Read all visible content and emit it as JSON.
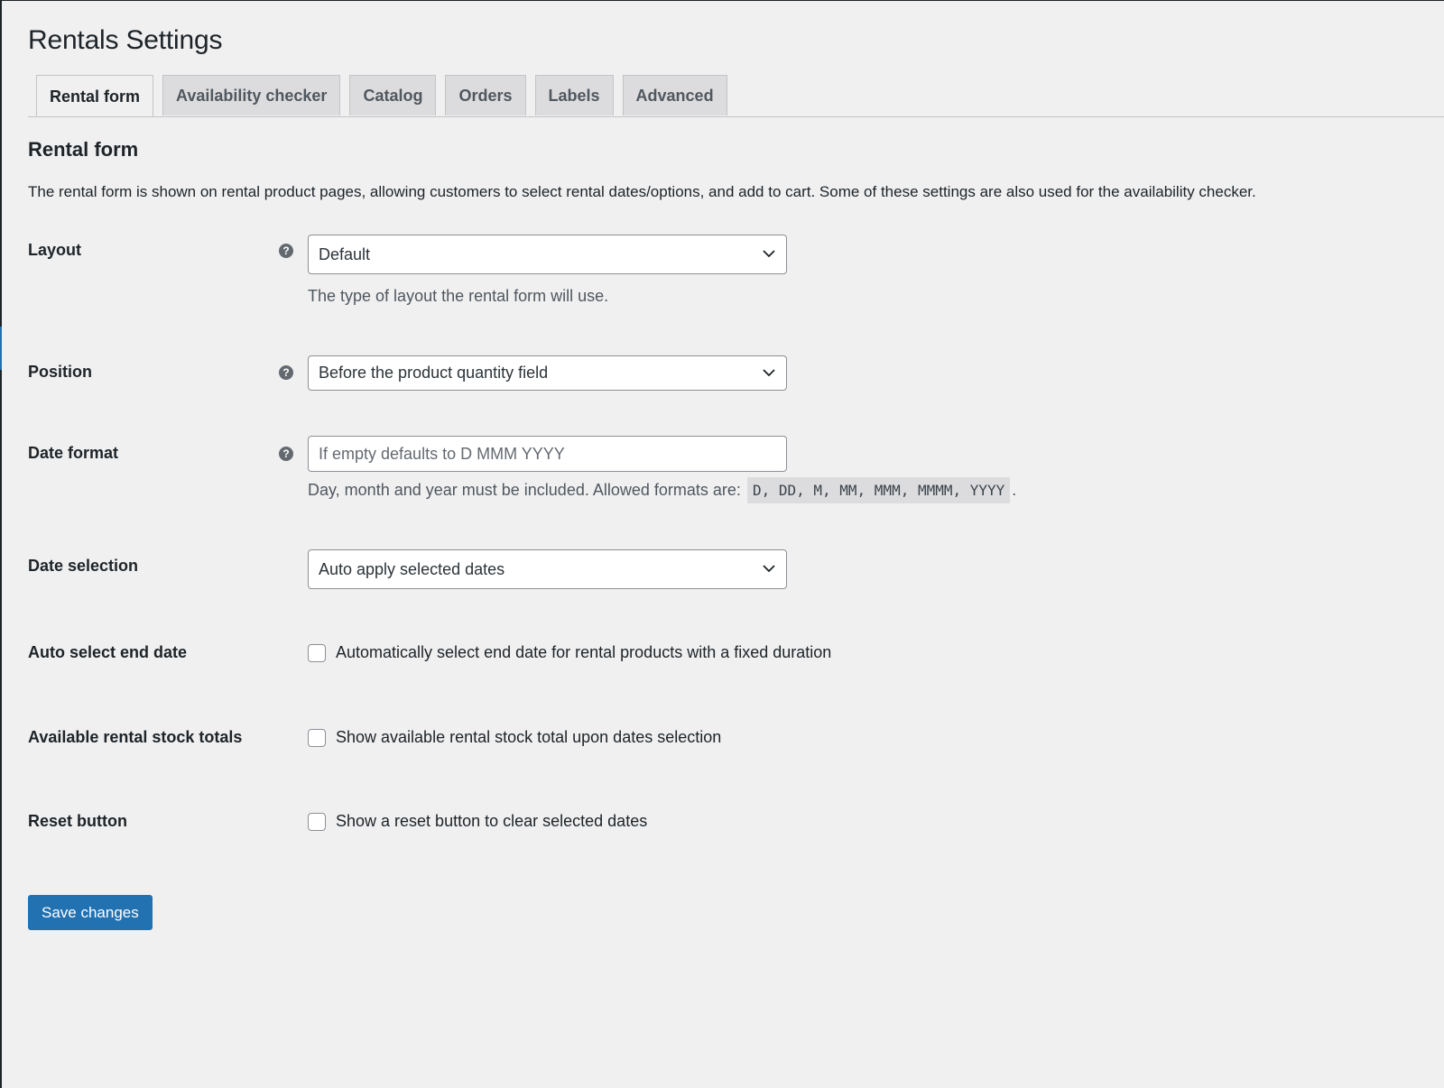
{
  "page": {
    "title": "Rentals Settings"
  },
  "tabs": [
    {
      "label": "Rental form",
      "active": true
    },
    {
      "label": "Availability checker",
      "active": false
    },
    {
      "label": "Catalog",
      "active": false
    },
    {
      "label": "Orders",
      "active": false
    },
    {
      "label": "Labels",
      "active": false
    },
    {
      "label": "Advanced",
      "active": false
    }
  ],
  "section": {
    "title": "Rental form",
    "description": "The rental form is shown on rental product pages, allowing customers to select rental dates/options, and add to cart. Some of these settings are also used for the availability checker."
  },
  "fields": {
    "layout": {
      "label": "Layout",
      "value": "Default",
      "description": "The type of layout the rental form will use."
    },
    "position": {
      "label": "Position",
      "value": "Before the product quantity field"
    },
    "date_format": {
      "label": "Date format",
      "value": "",
      "placeholder": "If empty defaults to D MMM YYYY",
      "description_prefix": "Day, month and year must be included. Allowed formats are:",
      "allowed_formats": "D, DD, M, MM, MMM, MMMM, YYYY",
      "description_suffix": "."
    },
    "date_selection": {
      "label": "Date selection",
      "value": "Auto apply selected dates"
    },
    "auto_select_end_date": {
      "label": "Auto select end date",
      "checkbox_label": "Automatically select end date for rental products with a fixed duration",
      "checked": false
    },
    "available_stock_totals": {
      "label": "Available rental stock totals",
      "checkbox_label": "Show available rental stock total upon dates selection",
      "checked": false
    },
    "reset_button": {
      "label": "Reset button",
      "checkbox_label": "Show a reset button to clear selected dates",
      "checked": false
    }
  },
  "actions": {
    "save_label": "Save changes"
  },
  "icons": {
    "help": "help-icon",
    "chevron": "chevron-down-icon"
  },
  "colors": {
    "background": "#f0f0f1",
    "primary_button": "#2271b1",
    "tab_inactive": "#dcdcde"
  }
}
